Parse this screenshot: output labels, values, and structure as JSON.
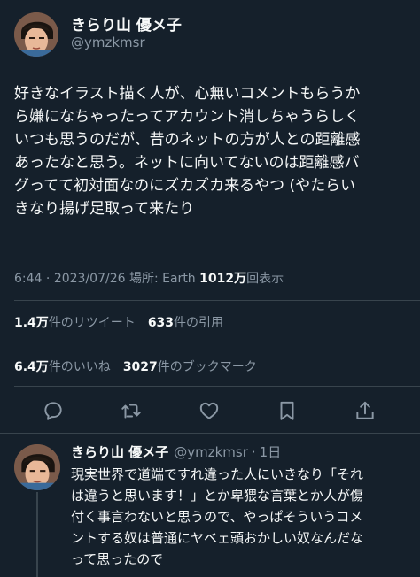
{
  "tweet": {
    "author_name": "きらり山 優メ子",
    "author_handle": "@ymzkmsr",
    "text_lines": [
      "好きなイラスト描く人が、心無いコメントもらうか",
      "ら嫌になちゃったってアカウント消しちゃうらしく",
      "いつも思うのだが、昔のネットの方が人との距離感",
      "あったなと思う。ネットに向いてないのは距離感バ",
      "グってて初対面なのにズカズカ来るやつ (やたらい",
      "きなり揚げ足取って来たり"
    ],
    "time": "6:44",
    "date": "2023/07/26",
    "location_label": "場所: Earth",
    "views_count": "1012万",
    "views_label": "回表示",
    "separator": "·"
  },
  "stats": {
    "retweets_count": "1.4万",
    "retweets_label": "件のリツイート",
    "quotes_count": "633",
    "quotes_label": "件の引用",
    "likes_count": "6.4万",
    "likes_label": "件のいいね",
    "bookmarks_count": "3027",
    "bookmarks_label": "件のブックマーク"
  },
  "actions": {
    "icons": [
      "reply-icon",
      "retweet-icon",
      "like-icon",
      "bookmark-icon",
      "share-icon"
    ]
  },
  "reply": {
    "author_name": "きらり山 優メ子",
    "author_handle": "@ymzkmsr",
    "separator": "·",
    "age": "1日",
    "text_lines": [
      "現実世界で道端ですれ違った人にいきなり「それ",
      "は違うと思います！」とか卑猥な言葉とか人が傷",
      "付く事言わないと思うので、やっぱそういうコメ",
      "ントする奴は普通にヤベェ頭おかしい奴なんだな",
      "って思ったので"
    ]
  },
  "colors": {
    "background": "#15202b",
    "text": "#f7f9f9",
    "secondary": "#8b98a5",
    "divider": "#38444d"
  }
}
